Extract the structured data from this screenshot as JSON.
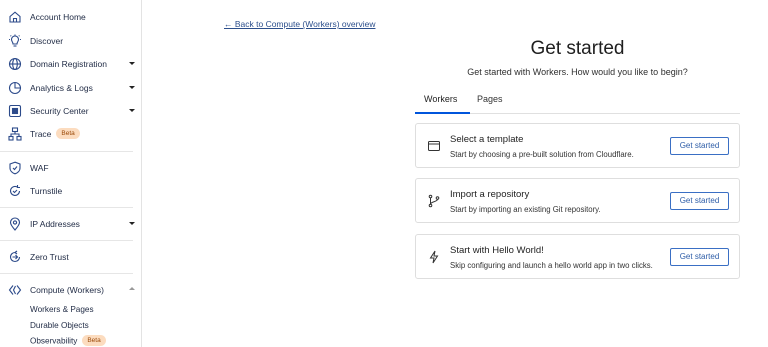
{
  "sidebar": {
    "items": [
      {
        "label": "Account Home",
        "icon": "home-icon"
      },
      {
        "label": "Discover",
        "icon": "lightbulb-icon"
      },
      {
        "label": "Domain Registration",
        "icon": "globe-icon"
      },
      {
        "label": "Analytics & Logs",
        "icon": "pie-chart-icon"
      },
      {
        "label": "Security Center",
        "icon": "security-center-icon"
      },
      {
        "label": "Trace",
        "icon": "trace-icon",
        "badge": "Beta"
      },
      {
        "label": "WAF",
        "icon": "shield-icon"
      },
      {
        "label": "Turnstile",
        "icon": "turnstile-icon"
      },
      {
        "label": "IP Addresses",
        "icon": "location-pin-icon"
      },
      {
        "label": "Zero Trust",
        "icon": "zero-trust-icon"
      },
      {
        "label": "Compute (Workers)",
        "icon": "workers-icon"
      }
    ],
    "sub_items": [
      {
        "label": "Workers & Pages"
      },
      {
        "label": "Durable Objects"
      },
      {
        "label": "Observability",
        "badge": "Beta"
      }
    ]
  },
  "main": {
    "back_link": "← Back to Compute (Workers) overview",
    "title": "Get started",
    "subtitle": "Get started with Workers. How would you like to begin?",
    "tabs": [
      {
        "label": "Workers",
        "active": true
      },
      {
        "label": "Pages",
        "active": false
      }
    ],
    "cards": [
      {
        "title": "Select a template",
        "description": "Start by choosing a pre-built solution from Cloudflare.",
        "button": "Get started",
        "icon": "browser-window-icon"
      },
      {
        "title": "Import a repository",
        "description": "Start by importing an existing Git repository.",
        "button": "Get started",
        "icon": "git-branch-icon"
      },
      {
        "title": "Start with Hello World!",
        "description": "Skip configuring and launch a hello world app in two clicks.",
        "button": "Get started",
        "icon": "lightning-bolt-icon"
      }
    ]
  },
  "colors": {
    "accent": "#0055dc",
    "link": "#2c4f8c",
    "icon": "#2c4a8a",
    "badge_bg": "#fcdcbf",
    "badge_text": "#9b4a09"
  }
}
